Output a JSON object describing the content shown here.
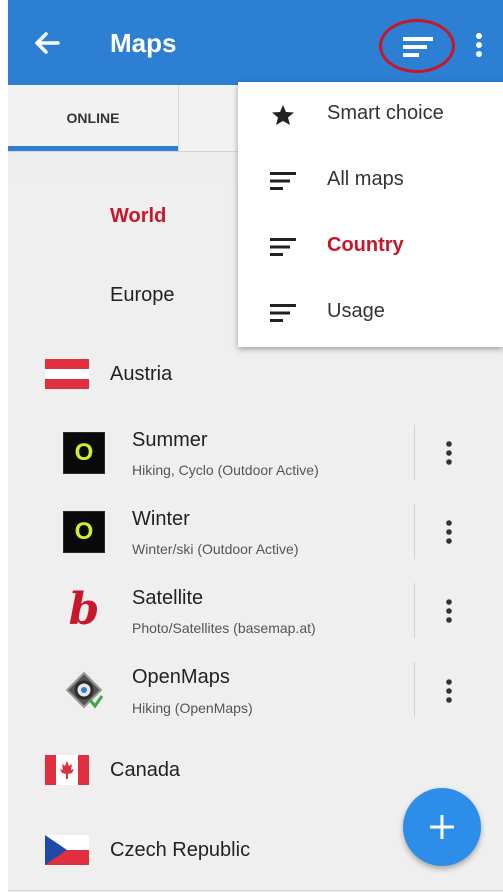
{
  "appbar": {
    "title": "Maps",
    "back_icon": "arrow-left-icon",
    "sort_icon": "sort-lines-icon",
    "more_icon": "more-vertical-icon",
    "color": "#2c7fd3"
  },
  "tabs": [
    {
      "label": "ONLINE",
      "active": true
    },
    {
      "label": "O"
    }
  ],
  "menu": {
    "items": [
      {
        "label": "Smart choice",
        "icon": "star-icon"
      },
      {
        "label": "All maps",
        "icon": "sort-lines-icon"
      },
      {
        "label": "Country",
        "icon": "sort-lines-icon",
        "selected": true
      },
      {
        "label": "Usage",
        "icon": "sort-lines-icon"
      }
    ]
  },
  "list": {
    "world": "World",
    "europe": "Europe",
    "countries": [
      {
        "name": "Austria",
        "flag": "austria-flag-icon"
      },
      {
        "name": "Canada",
        "flag": "canada-flag-icon"
      },
      {
        "name": "Czech Republic",
        "flag": "czech-flag-icon"
      }
    ],
    "maps": [
      {
        "title": "Summer",
        "subtitle": "Hiking, Cyclo (Outdoor Active)",
        "icon": "outdoor-active-icon",
        "icon_letter": "O"
      },
      {
        "title": "Winter",
        "subtitle": "Winter/ski (Outdoor Active)",
        "icon": "outdoor-active-icon",
        "icon_letter": "O"
      },
      {
        "title": "Satellite",
        "subtitle": "Photo/Satellites (basemap.at)",
        "icon": "basemap-icon",
        "icon_letter": "b"
      },
      {
        "title": "OpenMaps",
        "subtitle": "Hiking (OpenMaps)",
        "icon": "openmaps-icon"
      }
    ]
  },
  "fab": {
    "icon": "plus-icon"
  },
  "colors": {
    "accent": "#2c7fd3",
    "highlight_red": "#c8172b"
  }
}
